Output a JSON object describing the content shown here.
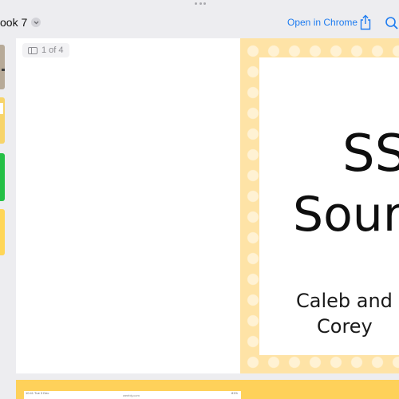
{
  "header": {
    "document_title": "ook 7",
    "open_in_chrome_label": "Open in Chrome",
    "accent_color": "#1e7cf0",
    "icons": [
      "more-dots-icon",
      "chevron-down-icon",
      "share-icon",
      "search-icon"
    ]
  },
  "viewer": {
    "page_counter": "1 of 4",
    "current_page": 1,
    "total_pages": 4
  },
  "sidebar": {
    "thumbnails": [
      "gray",
      "yellow",
      "green",
      "yellow"
    ]
  },
  "slide": {
    "title_line1": "SS",
    "title_line2": "Sour",
    "author_line1": "Caleb and",
    "author_line2": "Corey",
    "background_color": "#fee3a6",
    "dot_color": "#fff2d4"
  },
  "next_page": {
    "status_left": "10:41  Tue 3 Dec",
    "url": "weebly.com",
    "status_right": "81%"
  }
}
